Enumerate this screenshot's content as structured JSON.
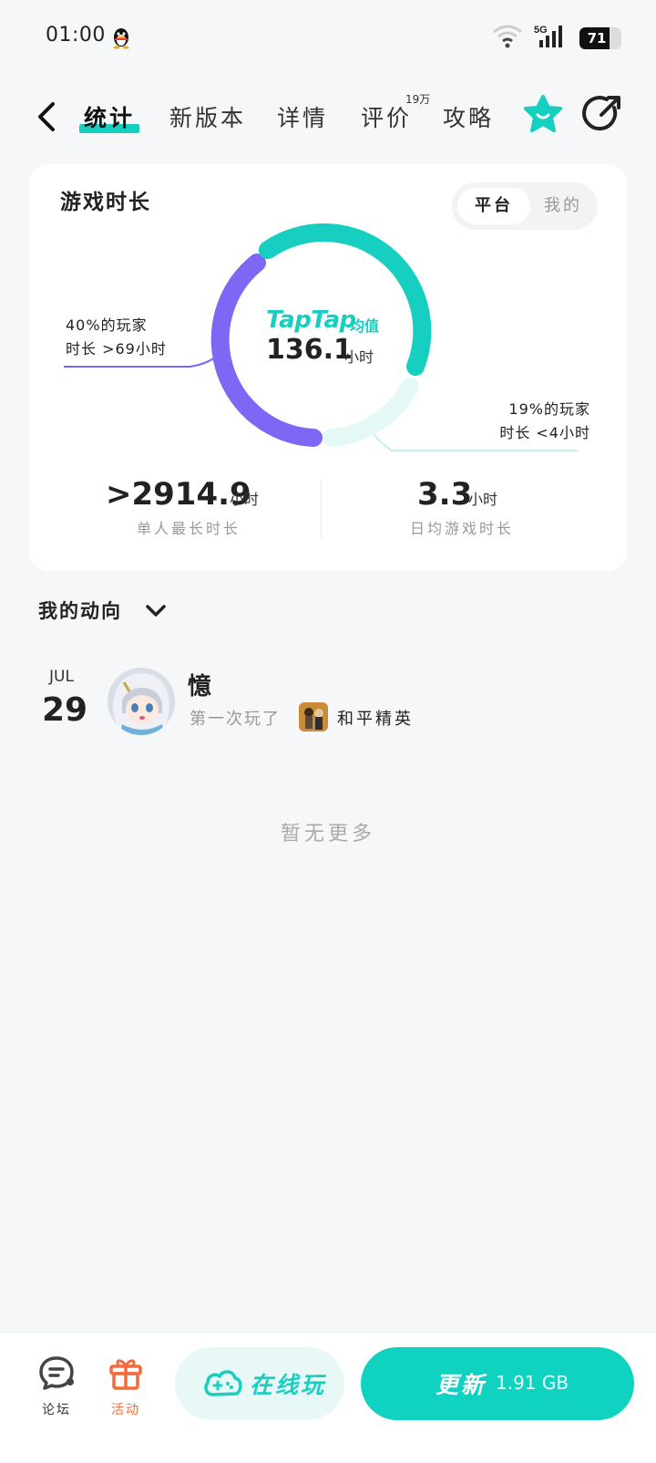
{
  "status_bar": {
    "time": "01:00",
    "network": "5G",
    "battery_level": "71",
    "battery_fraction": 0.71
  },
  "nav": {
    "tabs": [
      {
        "label": "统计",
        "active": true
      },
      {
        "label": "新版本"
      },
      {
        "label": "详情"
      },
      {
        "label": "评价",
        "badge": "19万"
      },
      {
        "label": "攻略"
      }
    ]
  },
  "stats_card": {
    "title": "游戏时长",
    "segment": {
      "platform": "平台",
      "mine": "我的"
    },
    "brand": "TapTap",
    "brand_suffix": "均值",
    "average_value": "136.1",
    "average_unit": "小时",
    "left_annotation": {
      "line1": "40%的玩家",
      "line2": "时长 >69小时"
    },
    "right_annotation": {
      "line1": "19%的玩家",
      "line2": "时长 <4小时"
    },
    "max_playtime": {
      "value": ">2914.9",
      "unit": "小时",
      "label": "单人最长时长"
    },
    "daily_avg": {
      "value": "3.3",
      "unit": "小时",
      "label": "日均游戏时长"
    },
    "colors": {
      "teal": "#17cfc0",
      "purple": "#7c68f5",
      "light_teal": "#e4f8f6"
    }
  },
  "activity": {
    "header": "我的动向",
    "items": [
      {
        "month": "JUL",
        "day": "29",
        "name": "憶",
        "desc": "第一次玩了",
        "game": "和平精英"
      }
    ],
    "empty_text": "暂无更多"
  },
  "bottom_bar": {
    "forum_label": "论坛",
    "activity_label": "活动",
    "play_label": "在线玩",
    "update_label": "更新",
    "update_size": "1.91 GB",
    "accent": "#0fd2c0",
    "activity_color": "#f26b3a"
  }
}
